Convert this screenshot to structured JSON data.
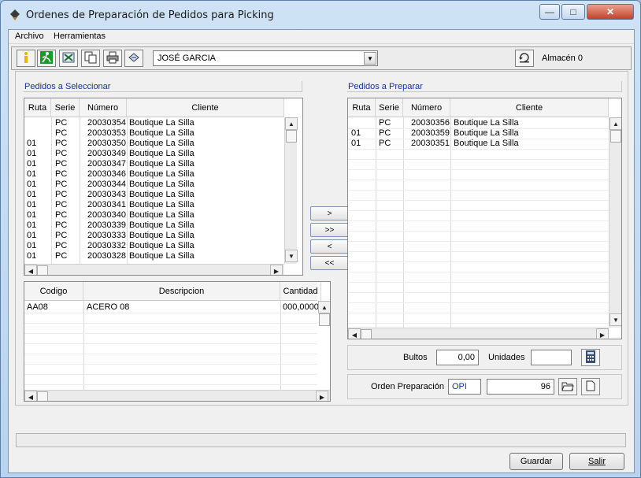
{
  "window": {
    "title": "Ordenes de Preparación de Pedidos para Picking",
    "minimize": "—",
    "maximize": "□",
    "close": "✕"
  },
  "menu": {
    "items": [
      "Archivo",
      "Herramientas"
    ]
  },
  "toolbar": {
    "buttons": [
      "info-icon",
      "exit-runner-icon",
      "excel-icon",
      "copy-icon",
      "print-icon",
      "hand-document-icon"
    ],
    "user_select": "JOSÉ GARCIA",
    "almacen_label": "Almacén 0"
  },
  "left": {
    "group_title": "Pedidos a Seleccionar",
    "columns": [
      "Ruta",
      "Serie",
      "Número",
      "Cliente"
    ],
    "rows": [
      {
        "ruta": "",
        "serie": "PC",
        "numero": "20030354",
        "cliente": "Boutique La Silla"
      },
      {
        "ruta": "",
        "serie": "PC",
        "numero": "20030353",
        "cliente": "Boutique La Silla"
      },
      {
        "ruta": "01",
        "serie": "PC",
        "numero": "20030350",
        "cliente": "Boutique La Silla"
      },
      {
        "ruta": "01",
        "serie": "PC",
        "numero": "20030349",
        "cliente": "Boutique La Silla"
      },
      {
        "ruta": "01",
        "serie": "PC",
        "numero": "20030347",
        "cliente": "Boutique La Silla"
      },
      {
        "ruta": "01",
        "serie": "PC",
        "numero": "20030346",
        "cliente": "Boutique La Silla"
      },
      {
        "ruta": "01",
        "serie": "PC",
        "numero": "20030344",
        "cliente": "Boutique La Silla"
      },
      {
        "ruta": "01",
        "serie": "PC",
        "numero": "20030343",
        "cliente": "Boutique La Silla"
      },
      {
        "ruta": "01",
        "serie": "PC",
        "numero": "20030341",
        "cliente": "Boutique La Silla"
      },
      {
        "ruta": "01",
        "serie": "PC",
        "numero": "20030340",
        "cliente": "Boutique La Silla"
      },
      {
        "ruta": "01",
        "serie": "PC",
        "numero": "20030339",
        "cliente": "Boutique La Silla"
      },
      {
        "ruta": "01",
        "serie": "PC",
        "numero": "20030333",
        "cliente": "Boutique La Silla"
      },
      {
        "ruta": "01",
        "serie": "PC",
        "numero": "20030332",
        "cliente": "Boutique La Silla"
      },
      {
        "ruta": "01",
        "serie": "PC",
        "numero": "20030328",
        "cliente": "Boutique La Silla"
      }
    ]
  },
  "detail": {
    "columns": [
      "Codigo",
      "Descripcion",
      "Cantidad"
    ],
    "rows": [
      {
        "codigo": "AA08",
        "descripcion": "ACERO 08",
        "cantidad": "000,0000"
      }
    ]
  },
  "move_buttons": [
    ">",
    ">>",
    "<",
    "<<"
  ],
  "right": {
    "group_title": "Pedidos a Preparar",
    "columns": [
      "Ruta",
      "Serie",
      "Número",
      "Cliente"
    ],
    "rows": [
      {
        "ruta": "",
        "serie": "PC",
        "numero": "20030356",
        "cliente": "Boutique La Silla"
      },
      {
        "ruta": "01",
        "serie": "PC",
        "numero": "20030359",
        "cliente": "Boutique La Silla"
      },
      {
        "ruta": "01",
        "serie": "PC",
        "numero": "20030351",
        "cliente": "Boutique La Silla"
      }
    ]
  },
  "totals": {
    "bultos_label": "Bultos",
    "bultos_value": "0,00",
    "unidades_label": "Unidades",
    "unidades_value": ""
  },
  "orden": {
    "label": "Orden Preparación",
    "serie": "OPI",
    "numero": "96"
  },
  "footer": {
    "guardar": "Guardar",
    "salir": "Salir"
  }
}
